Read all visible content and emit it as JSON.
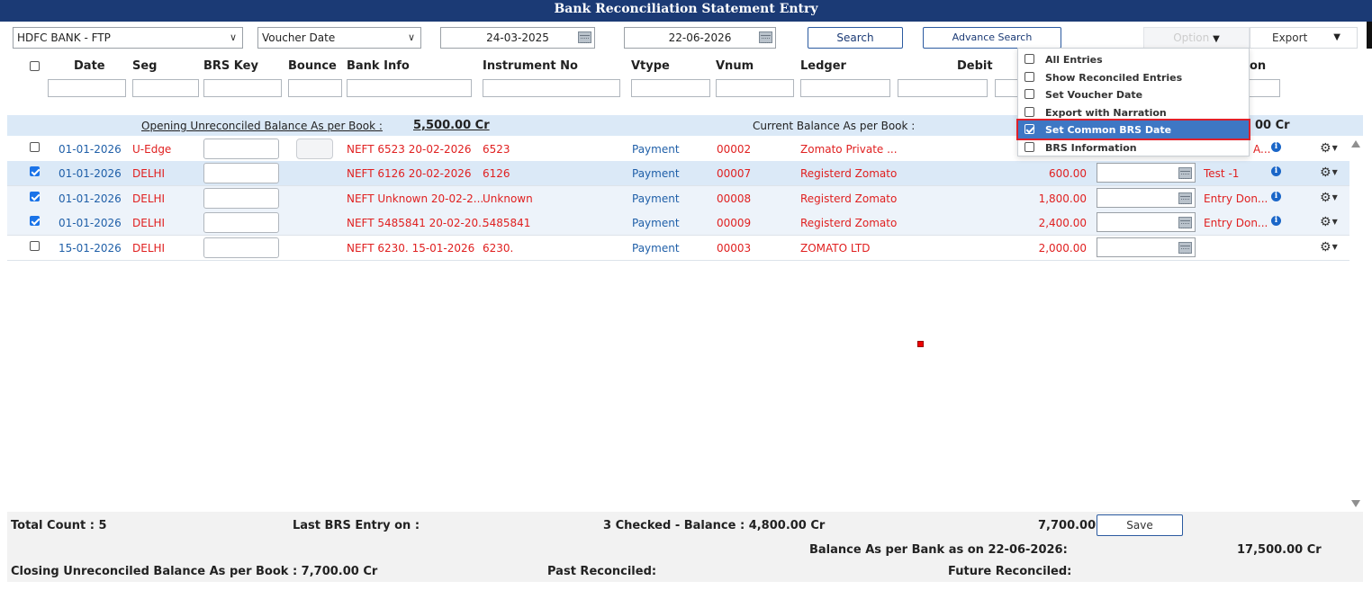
{
  "title": "Bank Reconciliation Statement Entry",
  "toolbar": {
    "bank_select": "HDFC BANK - FTP",
    "date_type_select": "Voucher Date",
    "from_date": "24-03-2025",
    "to_date": "22-06-2026",
    "search_label": "Search",
    "advance_search_label": "Advance Search",
    "option_label": "Option",
    "export_label": "Export"
  },
  "columns": {
    "date": "Date",
    "seg": "Seg",
    "brs_key": "BRS Key",
    "bounce": "Bounce",
    "bank_info": "Bank Info",
    "instrument_no": "Instrument No",
    "vtype": "Vtype",
    "vnum": "Vnum",
    "ledger": "Ledger",
    "debit": "Debit",
    "narration_partial": "on"
  },
  "balances": {
    "opening_label": "Opening Unreconciled Balance As per Book :",
    "opening_value": "5,500.00 Cr",
    "current_label": "Current Balance As per Book :",
    "current_value_partial": "00 Cr"
  },
  "rows": [
    {
      "checked": false,
      "date": "01-01-2026",
      "seg": "U-Edge",
      "bank_info": "NEFT 6523 20-02-2026",
      "instrument": "6523",
      "vtype": "Payment",
      "vnum": "00002",
      "ledger": "Zomato Private ...",
      "debit": "",
      "narration": "A..."
    },
    {
      "checked": true,
      "date": "01-01-2026",
      "seg": "DELHI",
      "bank_info": "NEFT 6126 20-02-2026",
      "instrument": "6126",
      "vtype": "Payment",
      "vnum": "00007",
      "ledger": "Registerd Zomato",
      "debit": "600.00",
      "narration": "Test -1"
    },
    {
      "checked": true,
      "date": "01-01-2026",
      "seg": "DELHI",
      "bank_info": "NEFT Unknown 20-02-2...",
      "instrument": "Unknown",
      "vtype": "Payment",
      "vnum": "00008",
      "ledger": "Registerd Zomato",
      "debit": "1,800.00",
      "narration": "Entry Don..."
    },
    {
      "checked": true,
      "date": "01-01-2026",
      "seg": "DELHI",
      "bank_info": "NEFT 5485841 20-02-20...",
      "instrument": "5485841",
      "vtype": "Payment",
      "vnum": "00009",
      "ledger": "Registerd Zomato",
      "debit": "2,400.00",
      "narration": "Entry Don..."
    },
    {
      "checked": false,
      "date": "15-01-2026",
      "seg": "DELHI",
      "bank_info": "NEFT 6230. 15-01-2026",
      "instrument": "6230.",
      "vtype": "Payment",
      "vnum": "00003",
      "ledger": "ZOMATO LTD",
      "debit": "2,000.00",
      "narration": ""
    }
  ],
  "options_menu": [
    {
      "label": "All Entries",
      "checked": false
    },
    {
      "label": "Show Reconciled Entries",
      "checked": false
    },
    {
      "label": "Set Voucher Date",
      "checked": false
    },
    {
      "label": "Export with Narration",
      "checked": false
    },
    {
      "label": "Set Common BRS Date",
      "checked": true
    },
    {
      "label": "BRS Information",
      "checked": false
    }
  ],
  "footer": {
    "total_count": "Total Count : 5",
    "last_brs_entry": "Last BRS Entry on :",
    "checked_balance": "3 Checked - Balance : 4,800.00 Cr",
    "total_debit": "7,700.00",
    "save_label": "Save",
    "bank_balance_label": "Balance As per Bank as on 22-06-2026:",
    "bank_balance_value": "17,500.00 Cr",
    "closing_label": "Closing Unreconciled Balance As per Book : 7,700.00 Cr",
    "past_reconciled": "Past Reconciled:",
    "future_reconciled": "Future Reconciled:"
  },
  "colors": {
    "title_bar": "#1b3a75",
    "link_blue": "#1f5fa8",
    "entry_red": "#e02020",
    "highlight_row": "#dbe9f7",
    "menu_active": "#3e77c4"
  }
}
